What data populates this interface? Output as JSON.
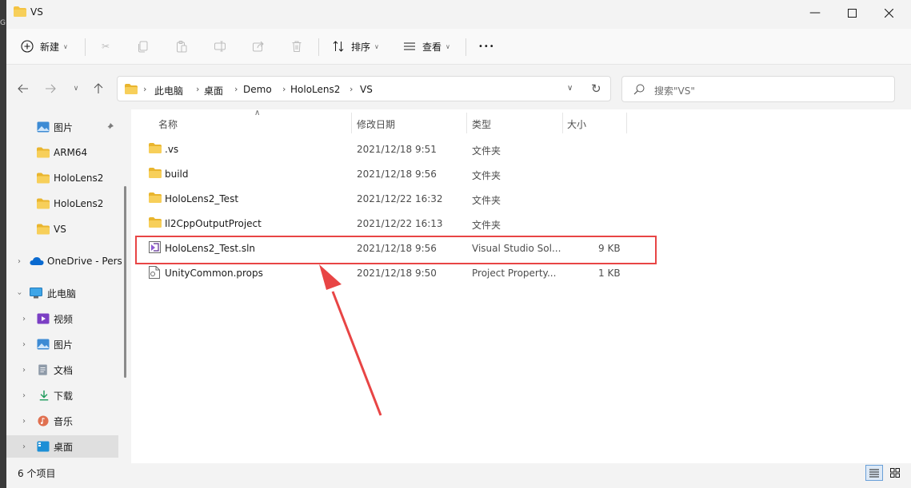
{
  "window": {
    "title": "VS"
  },
  "toolbar": {
    "new_label": "新建",
    "sort_label": "排序",
    "view_label": "查看",
    "more_label": "•••"
  },
  "address": {
    "crumbs": [
      "此电脑",
      "桌面",
      "Demo",
      "HoloLens2",
      "VS"
    ]
  },
  "search": {
    "placeholder": "搜索\"VS\""
  },
  "nav": {
    "quick": [
      {
        "label": "图片",
        "icon": "pictures-icon",
        "pinned": true
      },
      {
        "label": "ARM64",
        "icon": "folder-icon"
      },
      {
        "label": "HoloLens2",
        "icon": "folder-icon"
      },
      {
        "label": "HoloLens2",
        "icon": "folder-icon"
      },
      {
        "label": "VS",
        "icon": "folder-icon"
      }
    ],
    "onedrive": "OneDrive - Pers",
    "thispc": "此电脑",
    "pc_items": [
      {
        "label": "视频",
        "icon": "videos-icon"
      },
      {
        "label": "图片",
        "icon": "pictures-icon"
      },
      {
        "label": "文档",
        "icon": "documents-icon"
      },
      {
        "label": "下载",
        "icon": "downloads-icon"
      },
      {
        "label": "音乐",
        "icon": "music-icon"
      },
      {
        "label": "桌面",
        "icon": "desktop-icon",
        "selected": true
      }
    ]
  },
  "columns": {
    "name": "名称",
    "modified": "修改日期",
    "type": "类型",
    "size": "大小"
  },
  "files": [
    {
      "name": ".vs",
      "modified": "2021/12/18 9:51",
      "type": "文件夹",
      "size": "",
      "icon": "folder-icon"
    },
    {
      "name": "build",
      "modified": "2021/12/18 9:56",
      "type": "文件夹",
      "size": "",
      "icon": "folder-icon"
    },
    {
      "name": "HoloLens2_Test",
      "modified": "2021/12/22 16:32",
      "type": "文件夹",
      "size": "",
      "icon": "folder-icon"
    },
    {
      "name": "Il2CppOutputProject",
      "modified": "2021/12/22 16:13",
      "type": "文件夹",
      "size": "",
      "icon": "folder-icon"
    },
    {
      "name": "HoloLens2_Test.sln",
      "modified": "2021/12/18 9:56",
      "type": "Visual Studio Sol...",
      "size": "9 KB",
      "icon": "sln-file-icon"
    },
    {
      "name": "UnityCommon.props",
      "modified": "2021/12/18 9:50",
      "type": "Project Property...",
      "size": "1 KB",
      "icon": "props-file-icon"
    }
  ],
  "status": {
    "count": "6 个项目"
  },
  "colors": {
    "annotation": "#e84545",
    "folder": "#f4c342",
    "accent": "#0067c0"
  }
}
